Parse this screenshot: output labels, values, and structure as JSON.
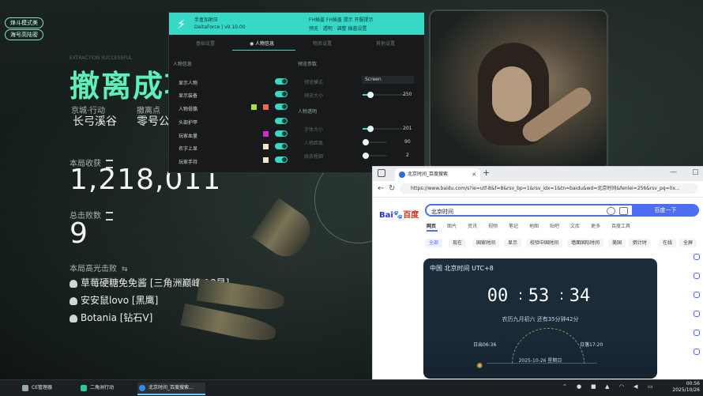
{
  "game": {
    "mode_tags": [
      "烽斗模式美",
      "海号高陆密"
    ],
    "status_faint": "EXTRACTION SUCCESSFUL",
    "status_title": "撤离成功",
    "map_label": "京城·行动",
    "map_value": "长弓溪谷",
    "point_label": "撤离点",
    "point_value": "零号公",
    "income_label": "本局收获",
    "income_value": "1,218,011",
    "total_label": "总击败数",
    "total_value": "9",
    "teammates_label": "本局高光击败",
    "teammates": [
      "草莓硬糖免免酱 [三角洲巅峰 18星]",
      "安安鼠lovo [黑鹰]",
      "Botania [钻石V]"
    ]
  },
  "overlay": {
    "header_left_1": "手盒加射压",
    "header_left_2": "DeltaForce | v9.10.00",
    "header_right_1": "FH插盖 FH插盖 提示 开服提示",
    "header_right_2": "预览 · 透明 · 调整 插盖设置",
    "tabs": [
      "基础设置",
      "人物信息",
      "物资设置",
      "其他设置"
    ],
    "active_tab": 1,
    "sec_people": "人物信息",
    "sec_preview": "预览参数",
    "sec_alpha": "人物透明",
    "rows": [
      {
        "label": "显示人物"
      },
      {
        "label": "显示装备"
      },
      {
        "label": "人物骨骼"
      },
      {
        "label": "头部护甲"
      },
      {
        "label": "玩家血量"
      },
      {
        "label": "名字上显"
      },
      {
        "label": "玩家手持"
      }
    ],
    "preview_rows": [
      {
        "label": "预览模式",
        "value": "Screen"
      },
      {
        "label": "预览大小",
        "value": "250"
      }
    ],
    "alpha_rows": [
      {
        "label": "字体大小",
        "value": "201"
      },
      {
        "label": "人物距离",
        "value": "90"
      },
      {
        "label": "线条粗细",
        "value": "2"
      }
    ],
    "accent": "#37d8c6"
  },
  "browser": {
    "tab_title": "北京时间_百度搜索",
    "url": "https://www.baidu.com/s?ie=utf-8&f=8&rsv_bp=1&rsv_idx=1&tn=baidu&wd=北京时间&fenlei=256&rsv_pq=0x...",
    "logo_text": "Bai",
    "logo_text_2": "百度",
    "search_value": "北京时间",
    "search_button": "百度一下",
    "nav": [
      "网页",
      "图片",
      "资讯",
      "视频",
      "笔记",
      "地图",
      "贴吧",
      "文库",
      "更多",
      "百度工具"
    ],
    "chips": [
      "全部",
      "现在",
      "国家时间",
      "显示",
      "校验中国时间",
      "墙面国际时间",
      "美国",
      "倒计时",
      "在线",
      "全屏"
    ],
    "clock_title": "中国 北京时间 UTC+8",
    "hours": "00",
    "minutes": "53",
    "seconds": "34",
    "date_line": "农历九月初六 还有35分钟42分",
    "sunrise": "日出06:36",
    "sunset": "日落17:20",
    "day_line": "2025-10-26 星期日"
  },
  "taskbar": {
    "items": [
      "CE管理器",
      "二角洲行动",
      "北京时间_百度搜索..."
    ],
    "time": "00:56",
    "date": "2025/10/26"
  }
}
